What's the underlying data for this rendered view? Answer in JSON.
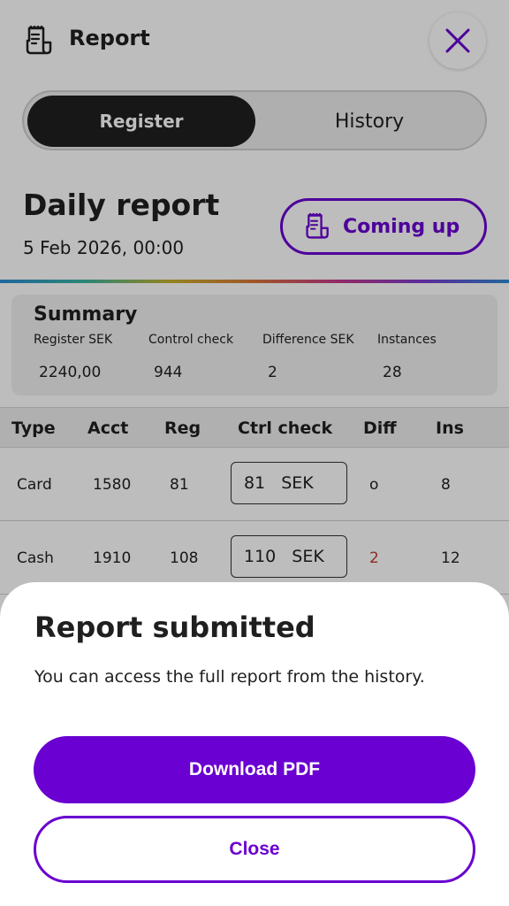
{
  "header": {
    "title": "Report",
    "icon": "receipt-icon",
    "close_icon": "close-icon"
  },
  "tabs": [
    {
      "label": "Register",
      "active": true
    },
    {
      "label": "History",
      "active": false
    }
  ],
  "report": {
    "title": "Daily report",
    "date": "5 Feb 2026, 00:00",
    "coming_up_label": "Coming up"
  },
  "summary": {
    "title": "Summary",
    "columns": [
      {
        "label": "Register SEK",
        "value": "2240,00"
      },
      {
        "label": "Control check",
        "value": "944"
      },
      {
        "label": "Difference SEK",
        "value": "2"
      },
      {
        "label": "Instances",
        "value": "28"
      }
    ]
  },
  "table": {
    "headers": [
      "Type",
      "Acct",
      "Reg",
      "Ctrl check",
      "Diff",
      "Ins"
    ],
    "rows": [
      {
        "type": "Card",
        "acct": "1580",
        "reg": "81",
        "ctrl_value": "81",
        "ctrl_unit": "SEK",
        "diff": "o",
        "ins": "8"
      },
      {
        "type": "Cash",
        "acct": "1910",
        "reg": "108",
        "ctrl_value": "110",
        "ctrl_unit": "SEK",
        "diff": "2",
        "ins": "12"
      }
    ]
  },
  "sheet": {
    "title": "Report submitted",
    "description": "You can access the full report from the history.",
    "primary_label": "Download PDF",
    "secondary_label": "Close"
  },
  "colors": {
    "accent": "#6a00d1",
    "dark": "#1f1f1f",
    "diff_negative": "#c23a2b"
  }
}
